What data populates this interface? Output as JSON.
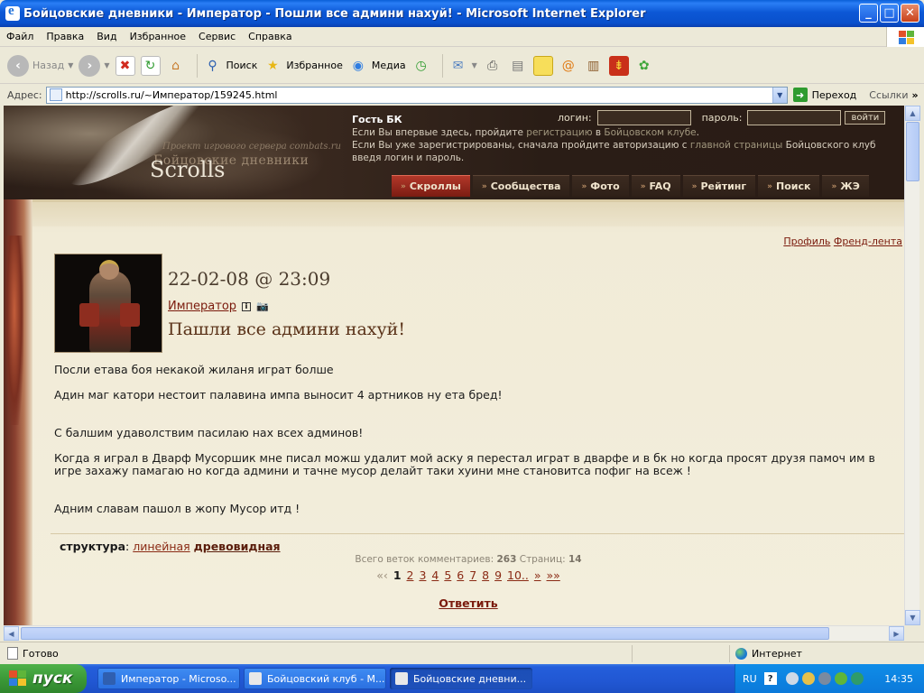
{
  "window": {
    "title": "Бойцовские дневники - Император - Пошли все админи нахуй! - Microsoft Internet Explorer",
    "minimize": "_",
    "maximize": "□",
    "close": "✕"
  },
  "menu": [
    "Файл",
    "Правка",
    "Вид",
    "Избранное",
    "Сервис",
    "Справка"
  ],
  "toolbar": {
    "back": "Назад",
    "search": "Поиск",
    "favorites": "Избранное",
    "media": "Медиа"
  },
  "address": {
    "label": "Адрес:",
    "url": "http://scrolls.ru/~Император/159245.html",
    "go": "Переход",
    "links": "Ссылки",
    "links_arrow": "»"
  },
  "site": {
    "project": "Проект игрового сервера combats.ru",
    "diaries": "Бойцовские дневники",
    "logo": "Scrolls",
    "guest": "Гость БК",
    "login_label": "логин:",
    "password_label": "пароль:",
    "login_button": "войти",
    "info_line1_pre": "Если Вы впервые здесь, пройдите ",
    "info_line1_link1": "регистрацию",
    "info_line1_mid": " в ",
    "info_line1_link2": "Бойцовском клубе",
    "info_line1_post": ".",
    "info_line2_pre": "Если Вы уже зарегистрированы, сначала пройдите авторизацию с ",
    "info_line2_link": "главной страницы",
    "info_line2_post": " Бойцовского клуб",
    "info_line3": "введя логин и пароль.",
    "nav": [
      "Скроллы",
      "Сообщества",
      "Фото",
      "FAQ",
      "Рейтинг",
      "Поиск",
      "ЖЭ"
    ],
    "nav_active": 0
  },
  "page": {
    "profile": "Профиль",
    "friends": "Френд-лента",
    "date": "22-02-08 @ 23:09",
    "author": "Император",
    "info_icon": "i",
    "photo_icon": "📷",
    "title": "Пашли все админи нахуй!",
    "body": [
      "Посли етава боя некакой жиланя играт болше",
      "Адин маг катори нестоит палавина импа выносит 4 артников ну ета бред!",
      "",
      "С балшим удаволствим пасилаю нах всех админов!",
      "Когда я играл в Дварф Мусоршик мне писал можш удалит мой аску я перестал играт в дварфе и в бк но когда просят друзя памоч им в игре захажу памагаю но когда админи и тачне мусор делайт таки хуини мне становитса пофиг на всеж !",
      "",
      "Адним славам пашол в жопу Мусор итд !"
    ],
    "structure_label": "структура",
    "structure_colon": ":",
    "linear": "линейная",
    "tree": "древовидная",
    "comments_pre": "Всего веток комментариев:",
    "comments_count": "263",
    "pages_label": "Страниц:",
    "pages_count": "14",
    "pager": {
      "first": "«‹",
      "prev": "«",
      "pages": [
        "1",
        "2",
        "3",
        "4",
        "5",
        "6",
        "7",
        "8",
        "9",
        "10.."
      ],
      "current": "1",
      "next": "»",
      "last": "»»"
    },
    "reply": "Ответить"
  },
  "status": {
    "text": "Готово",
    "zone": "Интернет"
  },
  "taskbar": {
    "start": "пуск",
    "tasks": [
      "Император - Microso...",
      "Бойцовский клуб - M...",
      "Бойцовские дневни..."
    ],
    "active_task": 2,
    "lang": "RU",
    "help": "?",
    "clock": "14:35"
  },
  "colors": {
    "accent_link": "#7a1a0c",
    "nav_active": "#b2382a",
    "titlebar": "#0c58d6",
    "taskbar": "#245edb",
    "start": "#3c9a38"
  }
}
